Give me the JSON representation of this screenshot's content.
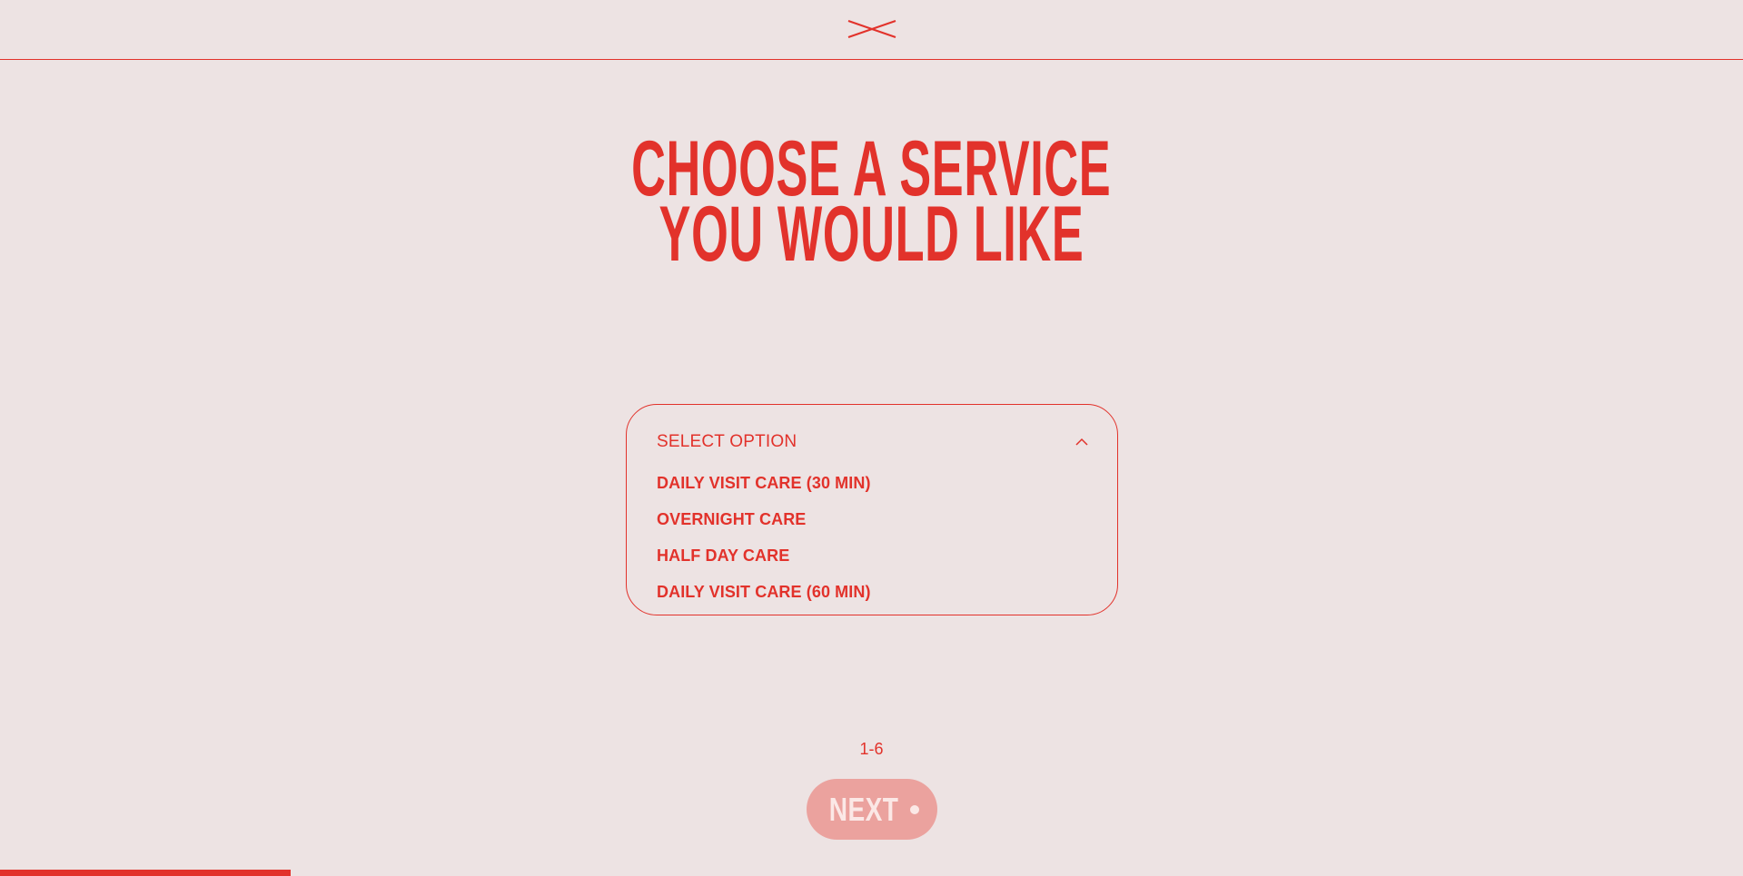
{
  "header": {
    "logo_icon": "crossed-lines-logo-icon"
  },
  "title": {
    "line1": "CHOOSE A SERVICE",
    "line2": "YOU WOULD LIKE"
  },
  "service_select": {
    "label": "SELECT OPTION",
    "chevron_icon": "chevron-up-icon",
    "expanded": true,
    "options": [
      "DAILY VISIT CARE (30 MIN)",
      "OVERNIGHT CARE",
      "HALF DAY CARE",
      "DAILY VISIT CARE (60 MIN)"
    ]
  },
  "step_indicator": "1-6",
  "next_button": {
    "label": "NEXT",
    "disabled": true
  },
  "progress": {
    "fraction": 0.167
  },
  "colors": {
    "background": "#ede3e3",
    "accent": "#e2322b",
    "button_disabled_bg": "#eba29e",
    "button_text": "#fbe8e6"
  }
}
